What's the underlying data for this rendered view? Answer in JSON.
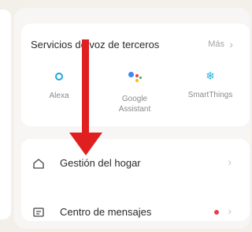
{
  "services": {
    "title": "Servicios de voz de terceros",
    "more_label": "Más",
    "items": [
      {
        "label": "Alexa",
        "icon": "alexa-icon"
      },
      {
        "label": "Google\nAssistant",
        "icon": "google-assistant-icon"
      },
      {
        "label": "SmartThings",
        "icon": "smartthings-icon"
      }
    ]
  },
  "menu": {
    "items": [
      {
        "label": "Gestión del hogar",
        "icon": "home-icon"
      },
      {
        "label": "Centro de mensajes",
        "icon": "message-icon",
        "has_badge": true
      }
    ]
  },
  "colors": {
    "accent": "#1da7d9",
    "annotation_arrow": "#e02020",
    "badge": "#e83d4a"
  }
}
